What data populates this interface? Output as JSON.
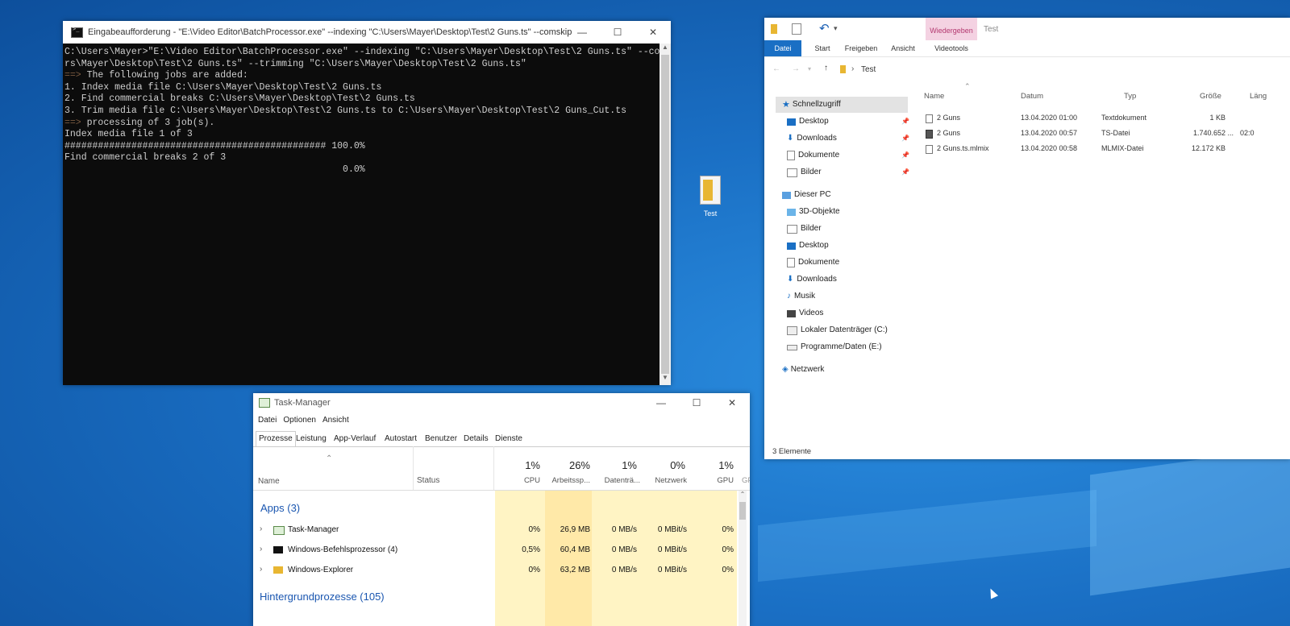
{
  "cmd": {
    "title": "Eingabeaufforderung - \"E:\\Video Editor\\BatchProcessor.exe\" --indexing \"C:\\Users\\Mayer\\Desktop\\Test\\2 Guns.ts\" --comskip \"C:\\User...",
    "lines": [
      "C:\\Users\\Mayer>\"E:\\Video Editor\\BatchProcessor.exe\" --indexing \"C:\\Users\\Mayer\\Desktop\\Test\\2 Guns.ts\" --comskip \"C:\\Use",
      "rs\\Mayer\\Desktop\\Test\\2 Guns.ts\" --trimming \"C:\\Users\\Mayer\\Desktop\\Test\\2 Guns.ts\"",
      "The following jobs are added:",
      "",
      "1. Index media file C:\\Users\\Mayer\\Desktop\\Test\\2 Guns.ts",
      "2. Find commercial breaks C:\\Users\\Mayer\\Desktop\\Test\\2 Guns.ts",
      "3. Trim media file C:\\Users\\Mayer\\Desktop\\Test\\2 Guns.ts to C:\\Users\\Mayer\\Desktop\\Test\\2 Guns_Cut.ts",
      "",
      "processing of 3 job(s).",
      "",
      "Index media file 1 of 3",
      "############################################### 100.0%",
      "",
      "Find commercial breaks 2 of 3",
      "                                                  0.0%"
    ],
    "arrow_prefix": "==> "
  },
  "explorer": {
    "ribbon_context_tab": "Wiedergeben",
    "ribbon_title": "Test",
    "tabs": [
      "Datei",
      "Start",
      "Freigeben",
      "Ansicht",
      "Videotools"
    ],
    "breadcrumb": "Test",
    "columns": [
      "Name",
      "Datum",
      "Typ",
      "Größe",
      "Läng"
    ],
    "nav": [
      {
        "label": "Schnellzugriff",
        "icon": "star-icon"
      },
      {
        "label": "Desktop",
        "icon": "desktop-icon",
        "pinned": true
      },
      {
        "label": "Downloads",
        "icon": "download-icon",
        "pinned": true
      },
      {
        "label": "Dokumente",
        "icon": "document-icon",
        "pinned": true
      },
      {
        "label": "Bilder",
        "icon": "pictures-icon",
        "pinned": true
      },
      {
        "label": "Dieser PC",
        "icon": "computer-icon"
      },
      {
        "label": "3D-Objekte",
        "icon": "cube-icon"
      },
      {
        "label": "Bilder",
        "icon": "pictures-icon"
      },
      {
        "label": "Desktop",
        "icon": "desktop-icon"
      },
      {
        "label": "Dokumente",
        "icon": "document-icon"
      },
      {
        "label": "Downloads",
        "icon": "download-icon"
      },
      {
        "label": "Musik",
        "icon": "music-icon"
      },
      {
        "label": "Videos",
        "icon": "video-icon"
      },
      {
        "label": "Lokaler Datenträger (C:)",
        "icon": "drive-icon"
      },
      {
        "label": "Programme/Daten (E:)",
        "icon": "drive-icon"
      },
      {
        "label": "Netzwerk",
        "icon": "network-icon"
      }
    ],
    "files": [
      {
        "name": "2 Guns",
        "date": "13.04.2020 01:00",
        "type": "Textdokument",
        "size": "1 KB",
        "length": ""
      },
      {
        "name": "2 Guns",
        "date": "13.04.2020 00:57",
        "type": "TS-Datei",
        "size": "1.740.652 ...",
        "length": "02:0"
      },
      {
        "name": "2 Guns.ts.mlmix",
        "date": "13.04.2020 00:58",
        "type": "MLMIX-Datei",
        "size": "12.172 KB",
        "length": ""
      }
    ],
    "status": "3 Elemente"
  },
  "desktop_icon": {
    "label": "Test"
  },
  "taskmgr": {
    "title": "Task-Manager",
    "menu": [
      "Datei",
      "Optionen",
      "Ansicht"
    ],
    "tabs": [
      "Prozesse",
      "Leistung",
      "App-Verlauf",
      "Autostart",
      "Benutzer",
      "Details",
      "Dienste"
    ],
    "headers": {
      "name": "Name",
      "status": "Status",
      "cpu": {
        "pct": "1%",
        "label": "CPU"
      },
      "mem": {
        "pct": "26%",
        "label": "Arbeitssp..."
      },
      "disk": {
        "pct": "1%",
        "label": "Datenträ..."
      },
      "net": {
        "pct": "0%",
        "label": "Netzwerk"
      },
      "gpu": {
        "pct": "1%",
        "label": "GPU"
      },
      "gpu2": "GP"
    },
    "apps_section": "Apps (3)",
    "apps": [
      {
        "name": "Task-Manager",
        "cpu": "0%",
        "mem": "26,9 MB",
        "disk": "0 MB/s",
        "net": "0 MBit/s",
        "gpu": "0%"
      },
      {
        "name": "Windows-Befehlsprozessor (4)",
        "cpu": "0,5%",
        "mem": "60,4 MB",
        "disk": "0 MB/s",
        "net": "0 MBit/s",
        "gpu": "0%"
      },
      {
        "name": "Windows-Explorer",
        "cpu": "0%",
        "mem": "63,2 MB",
        "disk": "0 MB/s",
        "net": "0 MBit/s",
        "gpu": "0%"
      }
    ],
    "bg_section": "Hintergrundprozesse (105)"
  }
}
